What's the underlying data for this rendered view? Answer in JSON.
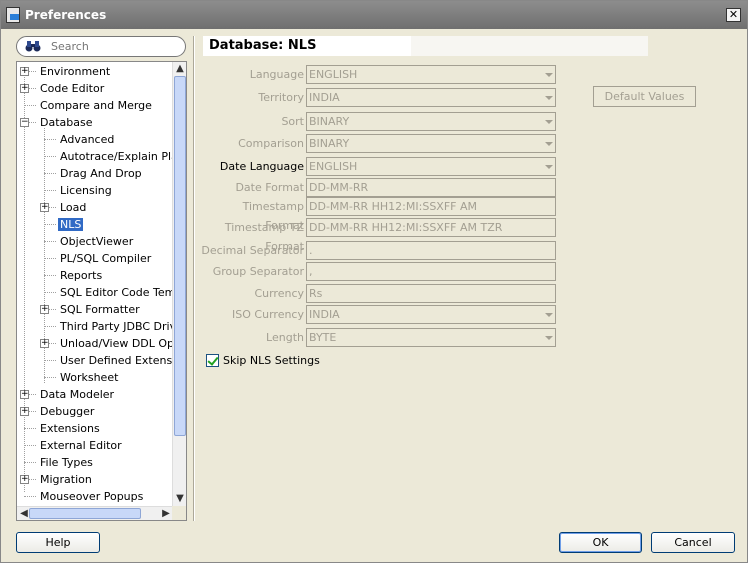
{
  "window": {
    "title": "Preferences",
    "close_glyph": "✕"
  },
  "search": {
    "placeholder": "Search",
    "value": ""
  },
  "tree": {
    "items": [
      {
        "label": "Environment",
        "expander": "+"
      },
      {
        "label": "Code Editor",
        "expander": "+"
      },
      {
        "label": "Compare and Merge",
        "expander": ""
      },
      {
        "label": "Database",
        "expander": "−"
      },
      {
        "label": "Advanced",
        "expander": ""
      },
      {
        "label": "Autotrace/Explain Plan",
        "expander": ""
      },
      {
        "label": "Drag And Drop",
        "expander": ""
      },
      {
        "label": "Licensing",
        "expander": ""
      },
      {
        "label": "Load",
        "expander": "+"
      },
      {
        "label": "NLS",
        "expander": ""
      },
      {
        "label": "ObjectViewer",
        "expander": ""
      },
      {
        "label": "PL/SQL Compiler",
        "expander": ""
      },
      {
        "label": "Reports",
        "expander": ""
      },
      {
        "label": "SQL Editor Code Templates",
        "expander": ""
      },
      {
        "label": "SQL Formatter",
        "expander": "+"
      },
      {
        "label": "Third Party JDBC Drivers",
        "expander": ""
      },
      {
        "label": "Unload/View DDL Options",
        "expander": "+"
      },
      {
        "label": "User Defined Extensions",
        "expander": ""
      },
      {
        "label": "Worksheet",
        "expander": ""
      },
      {
        "label": "Data Modeler",
        "expander": "+"
      },
      {
        "label": "Debugger",
        "expander": "+"
      },
      {
        "label": "Extensions",
        "expander": ""
      },
      {
        "label": "External Editor",
        "expander": ""
      },
      {
        "label": "File Types",
        "expander": ""
      },
      {
        "label": "Migration",
        "expander": "+"
      },
      {
        "label": "Mouseover Popups",
        "expander": ""
      }
    ],
    "selected": "NLS"
  },
  "page": {
    "title": "Database: NLS"
  },
  "form": {
    "rows": [
      {
        "label": "Language",
        "value": "ENGLISH",
        "dropdown": true
      },
      {
        "label": "Territory",
        "value": "INDIA",
        "dropdown": true
      },
      {
        "label": "Sort",
        "value": "BINARY",
        "dropdown": true
      },
      {
        "label": "Comparison",
        "value": "BINARY",
        "dropdown": true
      },
      {
        "label": "Date Language",
        "value": "ENGLISH",
        "dropdown": true
      },
      {
        "label": "Date Format",
        "value": "DD-MM-RR",
        "dropdown": false
      },
      {
        "label": "Timestamp Format",
        "value": "DD-MM-RR HH12:MI:SSXFF AM",
        "dropdown": false
      },
      {
        "label": "Timestamp TZ Format",
        "value": "DD-MM-RR HH12:MI:SSXFF AM TZR",
        "dropdown": false
      },
      {
        "label": "Decimal Separator",
        "value": ".",
        "dropdown": false
      },
      {
        "label": "Group Separator",
        "value": ",",
        "dropdown": false
      },
      {
        "label": "Currency",
        "value": "Rs",
        "dropdown": false
      },
      {
        "label": "ISO Currency",
        "value": "INDIA",
        "dropdown": true
      },
      {
        "label": "Length",
        "value": "BYTE",
        "dropdown": true
      }
    ],
    "default_values_label": "Default Values",
    "skip_nls": {
      "label": "Skip NLS Settings",
      "checked": true
    }
  },
  "buttons": {
    "help": "Help",
    "ok": "OK",
    "cancel": "Cancel"
  }
}
